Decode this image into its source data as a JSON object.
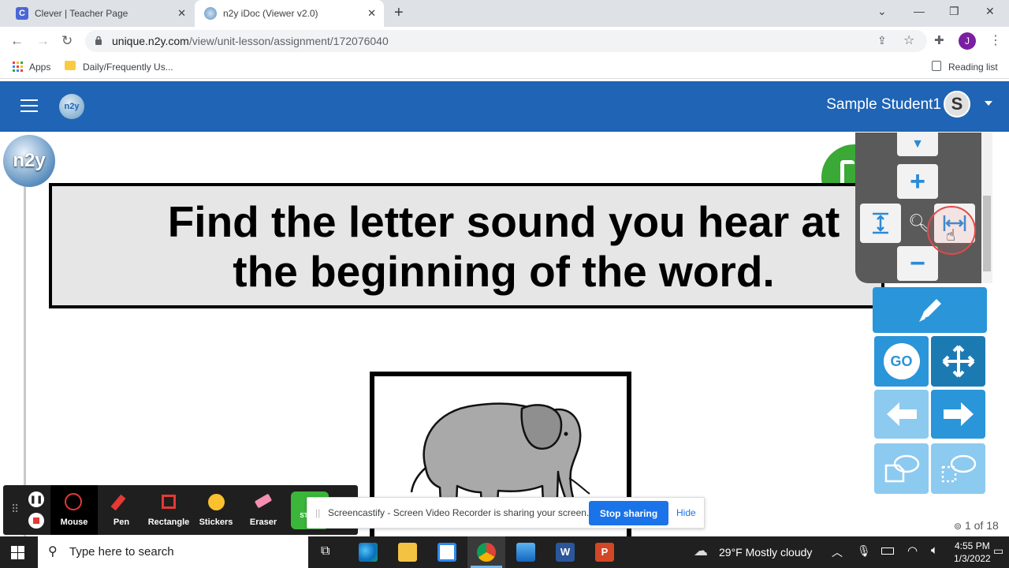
{
  "browser": {
    "tabs": [
      {
        "title": "Clever | Teacher Page",
        "favicon": "C"
      },
      {
        "title": "n2y iDoc (Viewer v2.0)"
      }
    ],
    "url_host": "unique.n2y.com",
    "url_path": "/view/unit-lesson/assignment/172076040",
    "profile_initial": "J",
    "bookmarks": {
      "apps": "Apps",
      "folder": "Daily/Frequently Us...",
      "reading_list": "Reading list"
    }
  },
  "app": {
    "logo_text": "n2y",
    "user_name": "Sample Student1",
    "avatar_initial": "S"
  },
  "document": {
    "title_line1": "Find the letter sound you hear at",
    "title_line2": "the beginning of the word.",
    "logo_text": "n2y",
    "page_indicator": "1 of 18",
    "picture": "elephant"
  },
  "tools": {
    "go_label": "GO"
  },
  "screencastify": {
    "items": [
      "Mouse",
      "Pen",
      "Rectangle",
      "Stickers",
      "Eraser"
    ],
    "partial_label": "ST WE",
    "share_text": "Screencastify - Screen Video Recorder is sharing your screen.",
    "stop_label": "Stop sharing",
    "hide_label": "Hide"
  },
  "taskbar": {
    "search_placeholder": "Type here to search",
    "weather": "29°F  Mostly cloudy",
    "time": "4:55 PM",
    "date": "1/3/2022"
  },
  "colors": {
    "header_blue": "#1f64b5",
    "tool_blue": "#2a95d9",
    "tool_light": "#8ccaf0",
    "stop_button": "#1a73e8"
  }
}
